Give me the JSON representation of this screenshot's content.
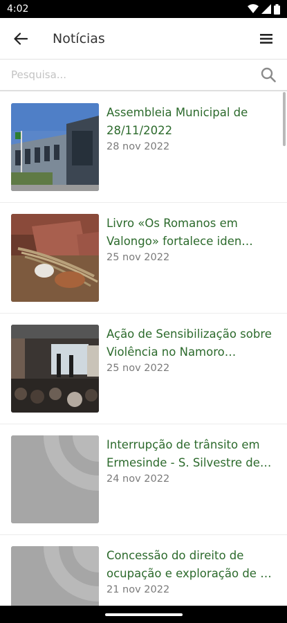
{
  "status_bar": {
    "time": "4:02"
  },
  "app_bar": {
    "title": "Notícias"
  },
  "search": {
    "placeholder": "Pesquisa..."
  },
  "news": [
    {
      "title": "Assembleia Municipal de 28/11/2022",
      "date": "28 nov 2022",
      "thumbnail": "building-photo"
    },
    {
      "title": "Livro «Os Romanos em Valongo» fortalece iden…",
      "date": "25 nov 2022",
      "thumbnail": "book-photo"
    },
    {
      "title": "Ação de Sensibilização sobre Violência no Namoro…",
      "date": "25 nov 2022",
      "thumbnail": "auditorium-photo"
    },
    {
      "title": "Interrupção de trânsito em Ermesinde - S. Silvestre de…",
      "date": "24 nov 2022",
      "thumbnail": "placeholder-image"
    },
    {
      "title": "Concessão do direito de ocupação e exploração de …",
      "date": "21 nov 2022",
      "thumbnail": "placeholder-image"
    }
  ],
  "colors": {
    "title_green": "#2c6a2c",
    "date_gray": "#7a7a7a",
    "placeholder_gray": "#a6a6a6"
  }
}
